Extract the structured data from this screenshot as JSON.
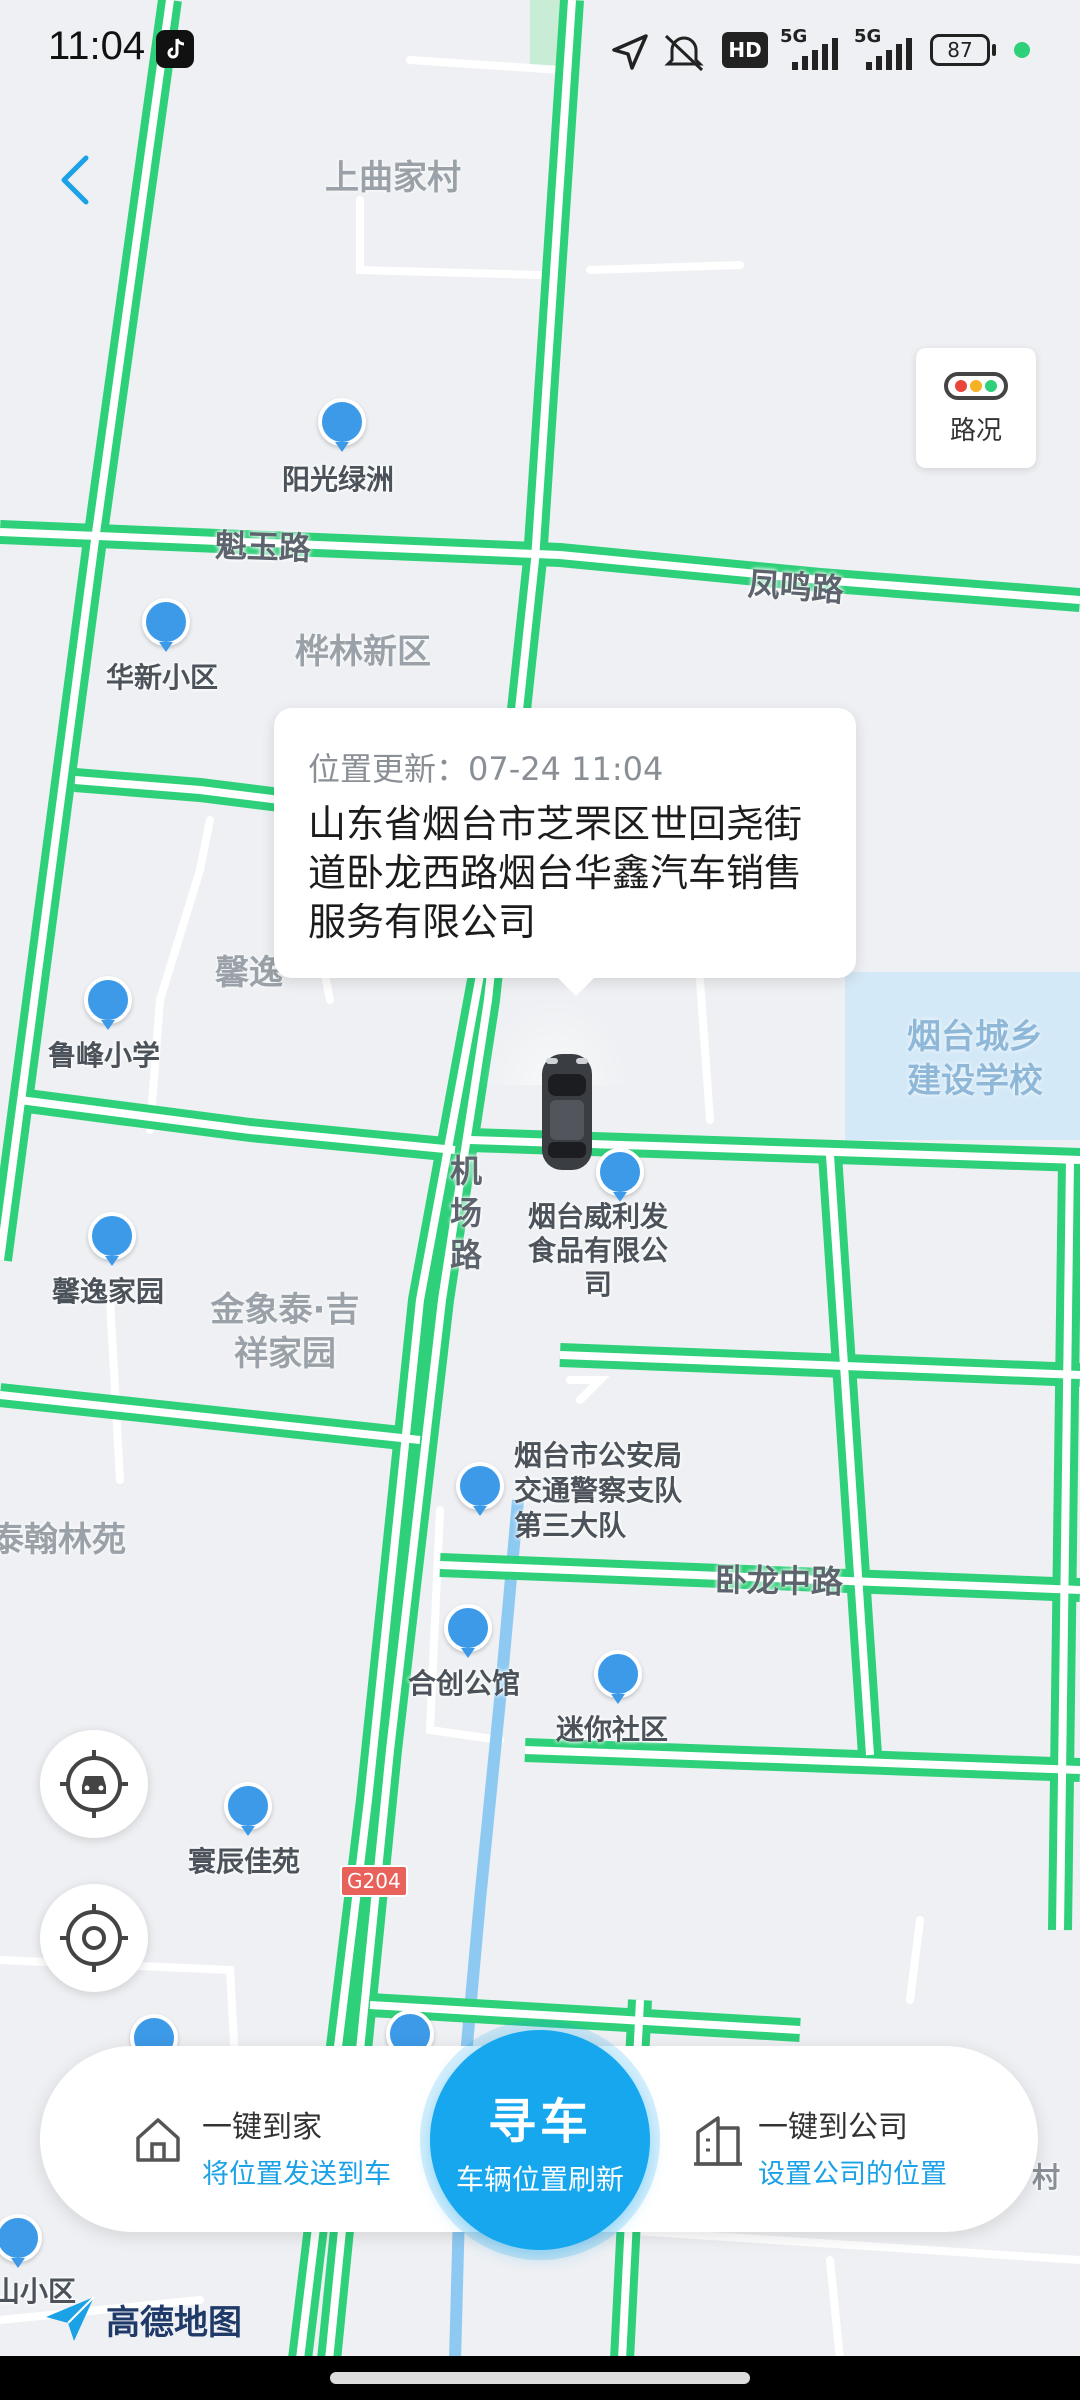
{
  "status_bar": {
    "time": "11:04",
    "network_hd": "HD",
    "signal_1": "5G",
    "signal_2": "5G",
    "battery": "87"
  },
  "map": {
    "roads": [
      "魁玉路",
      "凤鸣路",
      "机场路",
      "卧龙中路",
      "G204"
    ],
    "areas": [
      "上曲家村",
      "桦林新区",
      "烟台城乡建设学校",
      "金象泰·吉祥家园",
      "泰翰林苑",
      "馨逸"
    ],
    "pois": [
      "阳光绿洲",
      "华新小区",
      "鲁峰小学",
      "馨逸家园",
      "烟台威利发食品有限公司",
      "烟台市公安局交通警察支队第三大队",
      "合创公馆",
      "迷你社区",
      "寰辰佳苑",
      "山小区",
      "村"
    ],
    "provider": "高德地图"
  },
  "traffic_button": {
    "label": "路况"
  },
  "location_bubble": {
    "updated": "位置更新：07-24 11:04",
    "address": "山东省烟台市芝罘区世回尧街道卧龙西路烟台华鑫汽车销售服务有限公司"
  },
  "bottom_bar": {
    "home": {
      "title": "一键到家",
      "subtitle": "将位置发送到车"
    },
    "find_car": {
      "title": "寻车",
      "subtitle": "车辆位置刷新"
    },
    "company": {
      "title": "一键到公司",
      "subtitle": "设置公司的位置"
    }
  },
  "colors": {
    "road": "#2fd07a",
    "accent": "#16a7ef",
    "poi_pin": "#3d9ae8",
    "water": "#d4e9f7"
  },
  "icons": [
    "back-icon",
    "traffic-light-icon",
    "car-icon",
    "vehicle-locate-icon",
    "my-location-icon",
    "home-icon",
    "building-icon",
    "amap-logo-icon"
  ]
}
